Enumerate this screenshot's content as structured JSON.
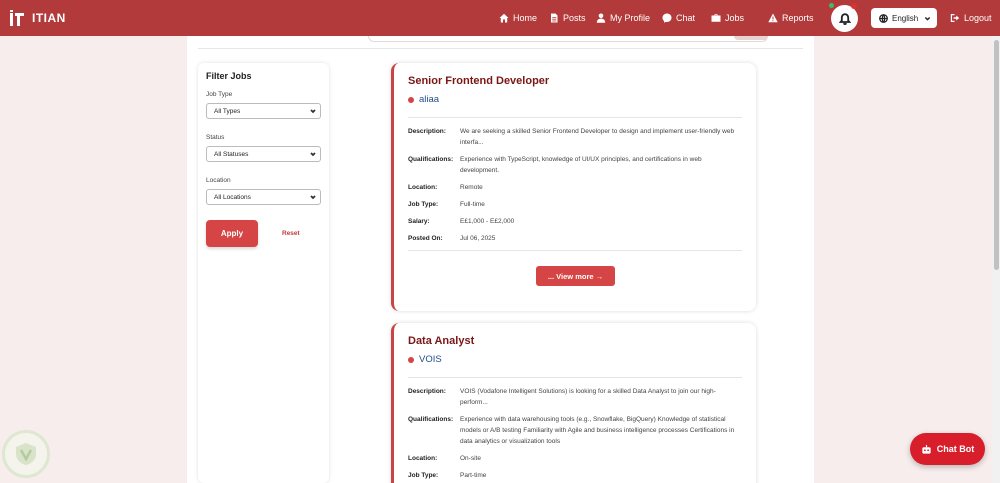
{
  "navbar": {
    "brand": "ITIAN",
    "links": {
      "home": "Home",
      "posts": "Posts",
      "profile": "My Profile",
      "chat": "Chat",
      "jobs": "Jobs",
      "reports": "Reports",
      "logout": "Logout"
    },
    "language": "English"
  },
  "filter": {
    "title": "Filter Jobs",
    "job_type_label": "Job Type",
    "job_type_value": "All Types",
    "status_label": "Status",
    "status_value": "All Statuses",
    "location_label": "Location",
    "location_value": "All Locations",
    "apply": "Apply",
    "reset": "Reset"
  },
  "labels": {
    "description": "Description:",
    "qualifications": "Qualifications:",
    "location": "Location:",
    "job_type": "Job Type:",
    "salary": "Salary:",
    "posted_on": "Posted On:",
    "view_more": "... View more →"
  },
  "jobs": [
    {
      "title": "Senior Frontend Developer",
      "company": "aliaa",
      "description": "We are seeking a skilled Senior Frontend Developer to design and implement user-friendly web interfa...",
      "qualifications": "Experience with TypeScript, knowledge of UI/UX principles, and certifications in web development.",
      "location": "Remote",
      "job_type": "Full-time",
      "salary": "E£1,000 - E£2,000",
      "posted_on": "Jul 06, 2025"
    },
    {
      "title": "Data Analyst",
      "company": "VOIS",
      "description": "VOIS (Vodafone Intelligent Solutions) is looking for a skilled Data Analyst to join our high-perform...",
      "qualifications": "Experience with data warehousing tools (e.g., Snowflake, BigQuery) Knowledge of statistical models or A/B testing Familiarity with Agile and business intelligence processes Certifications in data analytics or visualization tools",
      "location": "On-site",
      "job_type": "Part-time"
    }
  ],
  "chatbot": "Chat Bot",
  "colors": {
    "primary": "#b23a3a",
    "accent": "#d64545",
    "title": "#7a1616",
    "company": "#1f4f8a"
  }
}
